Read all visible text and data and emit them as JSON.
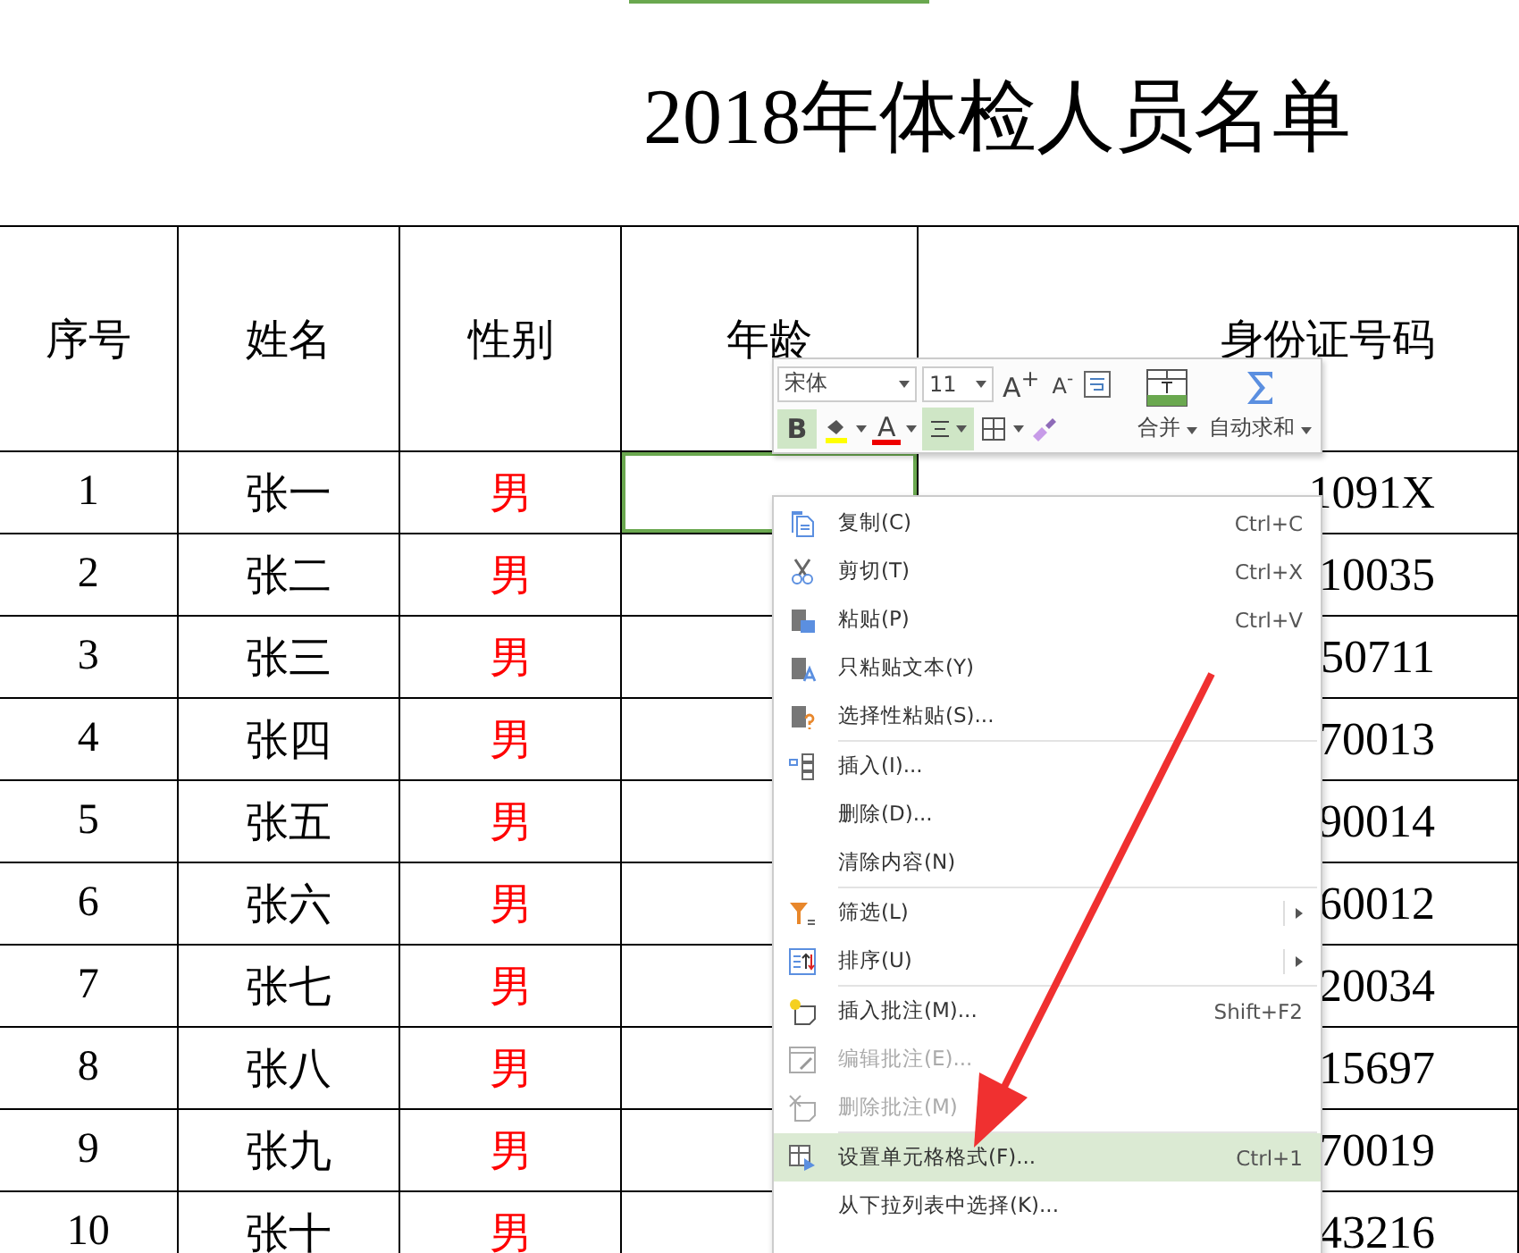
{
  "sheet": {
    "title": "2018年体检人员名单",
    "columns": [
      {
        "label": "序号",
        "selected": false
      },
      {
        "label": "姓名",
        "selected": false
      },
      {
        "label": "性别",
        "selected": false
      },
      {
        "label": "年龄",
        "selected": true
      },
      {
        "label": "身份证号码",
        "selected": false
      }
    ],
    "rows": [
      {
        "no": "1",
        "name": "张一",
        "gender": "男",
        "age_selected": true,
        "id": "1091X"
      },
      {
        "no": "2",
        "name": "张二",
        "gender": "男",
        "age_selected": false,
        "id": "10035"
      },
      {
        "no": "3",
        "name": "张三",
        "gender": "男",
        "age_selected": false,
        "id": "50711"
      },
      {
        "no": "4",
        "name": "张四",
        "gender": "男",
        "age_selected": false,
        "id": "70013"
      },
      {
        "no": "5",
        "name": "张五",
        "gender": "男",
        "age_selected": false,
        "id": "90014"
      },
      {
        "no": "6",
        "name": "张六",
        "gender": "男",
        "age_selected": false,
        "id": "60012"
      },
      {
        "no": "7",
        "name": "张七",
        "gender": "男",
        "age_selected": false,
        "id": "20034"
      },
      {
        "no": "8",
        "name": "张八",
        "gender": "男",
        "age_selected": false,
        "id": "15697"
      },
      {
        "no": "9",
        "name": "张九",
        "gender": "男",
        "age_selected": false,
        "id": "70019"
      },
      {
        "no": "10",
        "name": "张十",
        "gender": "男",
        "age_selected": false,
        "id": "43216"
      }
    ]
  },
  "mini_toolbar": {
    "font": "宋体",
    "size": "11",
    "grow": "A$^{+}$",
    "shrink": "A$^{-}$",
    "bold": {
      "label": "B",
      "selected": true
    },
    "font_color": "A",
    "align": {
      "selected": true
    },
    "merge": "合并",
    "autosum": "自动求和"
  },
  "context_menu": {
    "groups": [
      [
        {
          "label": "复制(C)",
          "shortcut": "Ctrl+C",
          "disabled": false,
          "selected": false,
          "submenu": false
        },
        {
          "label": "剪切(T)",
          "shortcut": "Ctrl+X",
          "disabled": false,
          "selected": false,
          "submenu": false
        },
        {
          "label": "粘贴(P)",
          "shortcut": "Ctrl+V",
          "disabled": false,
          "selected": false,
          "submenu": false
        },
        {
          "label": "只粘贴文本(Y)",
          "disabled": false,
          "selected": false,
          "submenu": false
        },
        {
          "label": "选择性粘贴(S)...",
          "disabled": false,
          "selected": false,
          "submenu": false
        }
      ],
      [
        {
          "label": "插入(I)...",
          "disabled": false,
          "selected": false,
          "submenu": false
        },
        {
          "label": "删除(D)...",
          "disabled": false,
          "selected": false,
          "submenu": false
        },
        {
          "label": "清除内容(N)",
          "disabled": false,
          "selected": false,
          "submenu": false
        }
      ],
      [
        {
          "label": "筛选(L)",
          "disabled": false,
          "selected": false,
          "submenu": true
        },
        {
          "label": "排序(U)",
          "disabled": false,
          "selected": false,
          "submenu": true
        }
      ],
      [
        {
          "label": "插入批注(M)...",
          "shortcut": "Shift+F2",
          "disabled": false,
          "selected": false,
          "submenu": false
        },
        {
          "label": "编辑批注(E)...",
          "disabled": true,
          "selected": false,
          "submenu": false
        },
        {
          "label": "删除批注(M)",
          "disabled": true,
          "selected": false,
          "submenu": false
        }
      ],
      [
        {
          "label": "设置单元格格式(F)...",
          "shortcut": "Ctrl+1",
          "disabled": false,
          "selected": true,
          "submenu": false
        },
        {
          "label": "从下拉列表中选择(K)...",
          "disabled": false,
          "selected": false,
          "submenu": false
        }
      ]
    ]
  }
}
